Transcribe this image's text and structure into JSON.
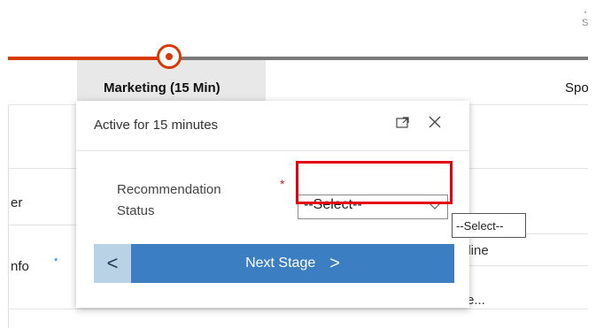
{
  "header": {
    "corner_char_a": "·",
    "corner_char_b": "S"
  },
  "stage_bar": {
    "active_stage_label": "Marketing  (15 Min)",
    "next_stage_label": "Spo"
  },
  "left_panel": {
    "row1_text": "er",
    "row2_text": "nfo",
    "row2_required_mark": "*"
  },
  "flyout": {
    "title": "Active for 15 minutes",
    "field": {
      "label": "Recommendation Status",
      "required_mark": "*",
      "selected_value": "--Select--"
    },
    "back_button_label": "<",
    "next_button_label": "Next Stage",
    "next_button_chevron": ">"
  },
  "dropdown": {
    "options": [
      "--Select--"
    ]
  },
  "right_panel": {
    "line1": "eline",
    "line2": "e..."
  },
  "colors": {
    "process_active": "#d83b01",
    "button_primary": "#3c7ec2",
    "button_secondary": "#b9d2e6",
    "annotation": "#e3000f"
  }
}
